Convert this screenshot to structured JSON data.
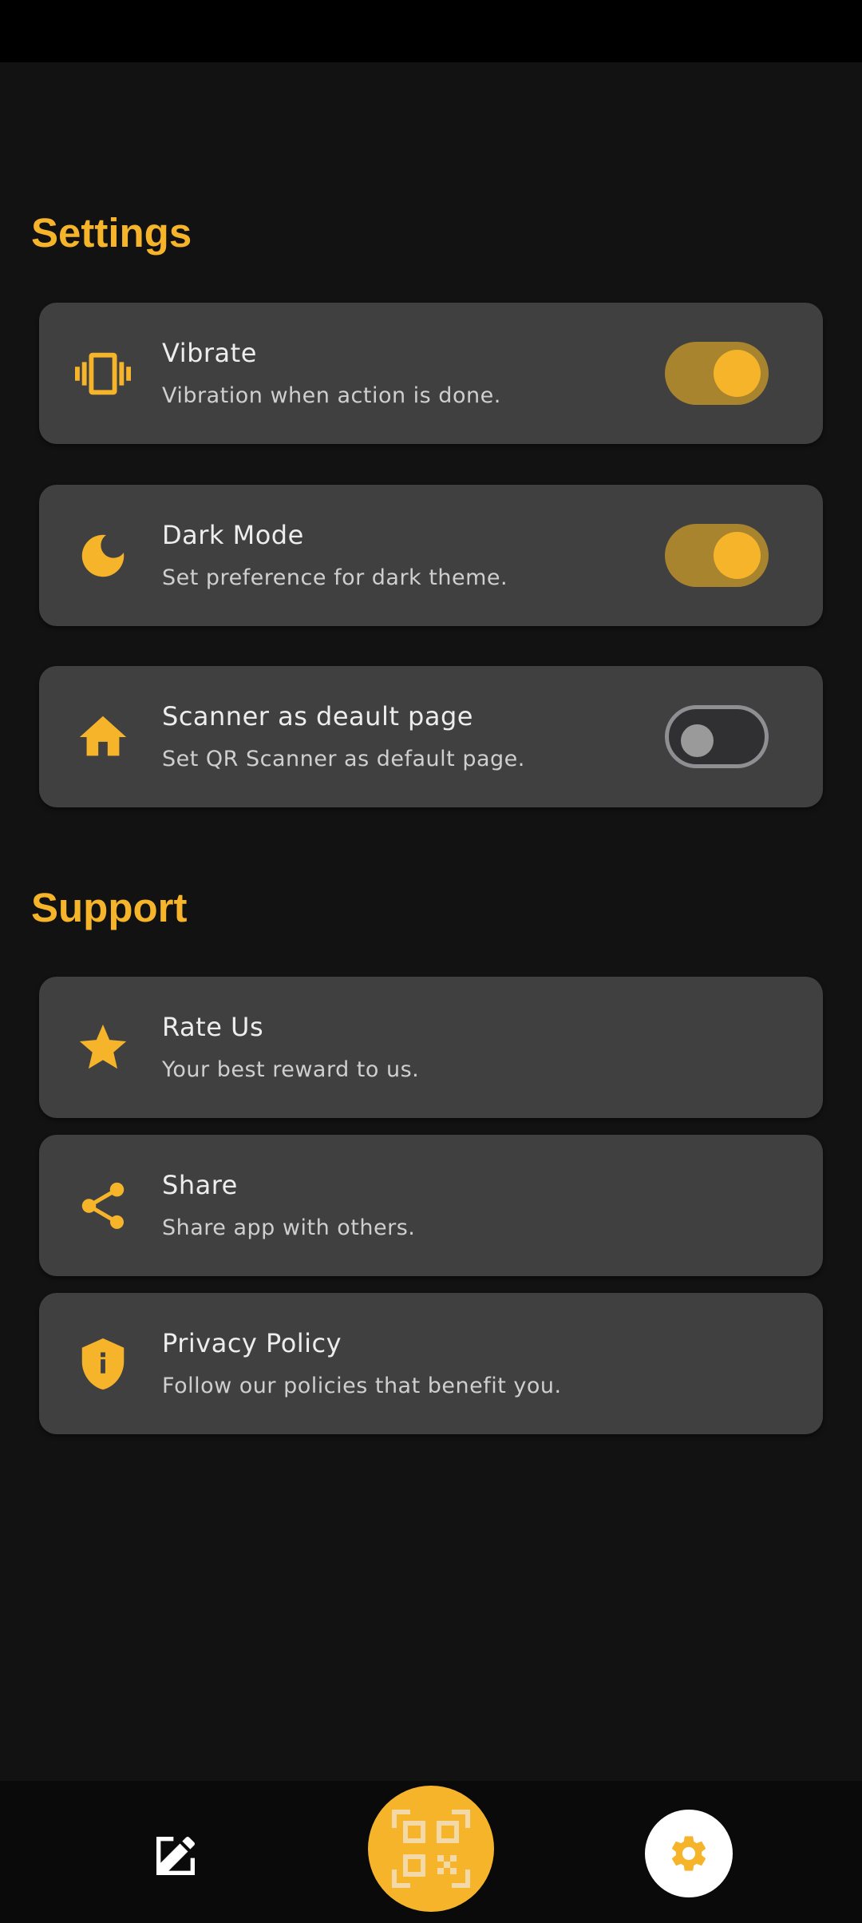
{
  "settings_section": {
    "title": "Settings",
    "items": [
      {
        "icon": "vibrate-icon",
        "title": "Vibrate",
        "subtitle": "Vibration when action is done.",
        "toggle": "on"
      },
      {
        "icon": "moon-icon",
        "title": "Dark Mode",
        "subtitle": "Set preference for dark theme.",
        "toggle": "on"
      },
      {
        "icon": "home-icon",
        "title": "Scanner as deault page",
        "subtitle": "Set QR Scanner as default page.",
        "toggle": "off"
      }
    ]
  },
  "support_section": {
    "title": "Support",
    "items": [
      {
        "icon": "star-icon",
        "title": "Rate Us",
        "subtitle": "Your best reward to us."
      },
      {
        "icon": "share-icon",
        "title": "Share",
        "subtitle": "Share app with others."
      },
      {
        "icon": "shield-icon",
        "title": "Privacy Policy",
        "subtitle": "Follow our policies that benefit you."
      }
    ]
  },
  "bottom_nav": {
    "items": [
      {
        "icon": "edit-icon",
        "active": false
      },
      {
        "icon": "qr-scan-icon",
        "active": false
      },
      {
        "icon": "gear-icon",
        "active": true
      }
    ]
  },
  "colors": {
    "accent": "#F6B42A",
    "background": "#121212",
    "card": "#404040"
  }
}
